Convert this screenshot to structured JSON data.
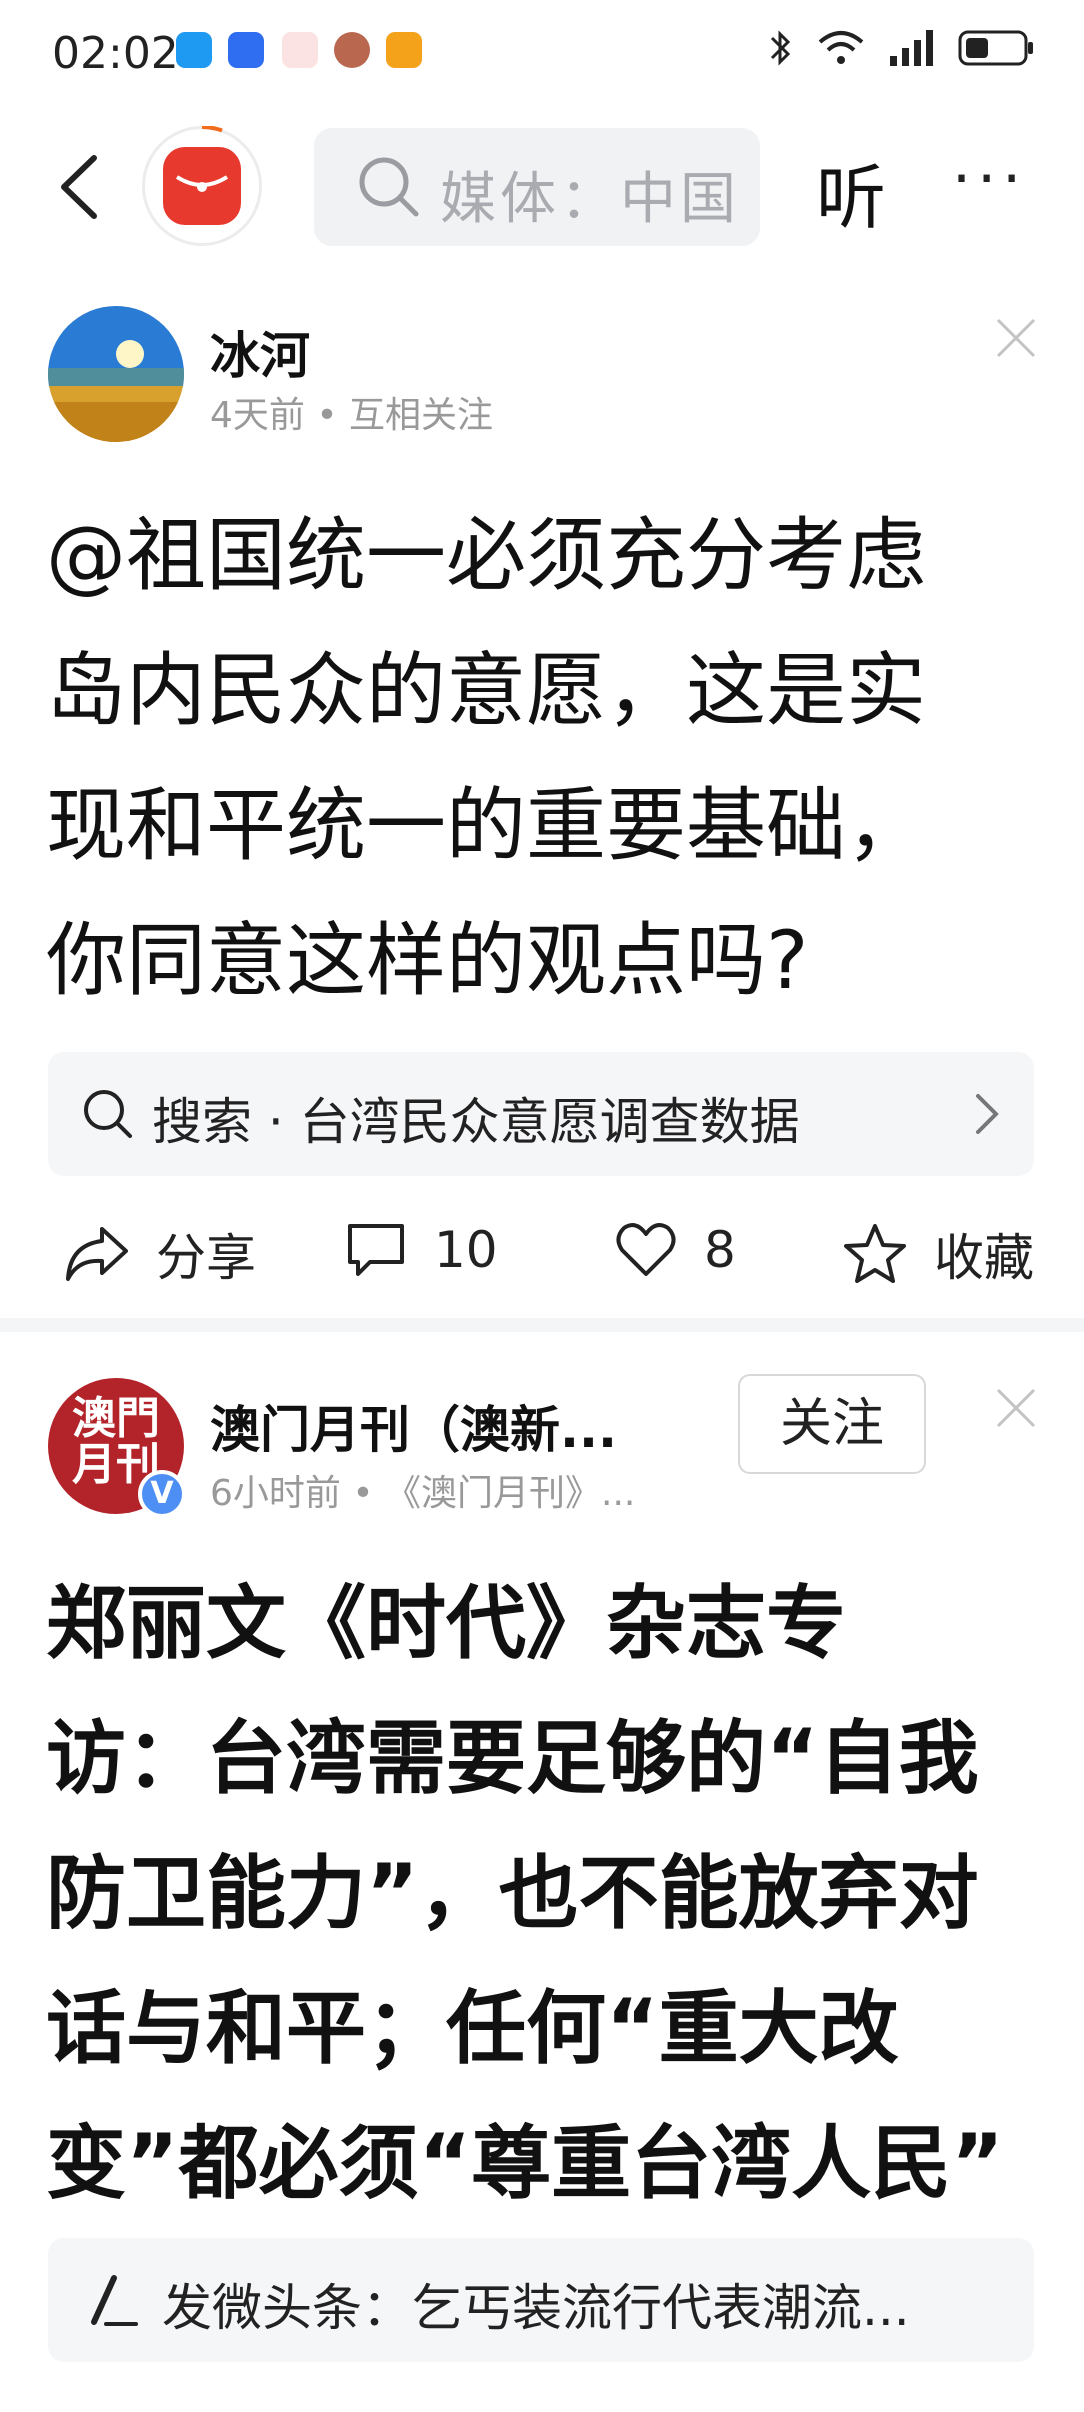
{
  "status_bar": {
    "time": "02:02",
    "notification_icons": [
      "chat-bubble-icon",
      "bulb-icon",
      "red-box-icon",
      "avatar-app-icon",
      "video-play-icon"
    ],
    "right_icons": [
      "bluetooth-icon",
      "wifi-icon",
      "signal-icon",
      "battery-icon"
    ]
  },
  "toolbar": {
    "search_placeholder": "媒体：中国",
    "listen_label": "听",
    "more_label": "···"
  },
  "feed": {
    "post1": {
      "author": "冰河",
      "meta": "4天前 • 互相关注",
      "headline_lines": [
        "@祖国统一必须充分考虑",
        "岛内民众的意愿，这是实",
        "现和平统一的重要基础，",
        "你同意这样的观点吗?"
      ],
      "search_suggestion": "搜索 · 台湾民众意愿调查数据",
      "share_label": "分享",
      "comments_count": "10",
      "likes_count": "8",
      "favorite_label": "收藏"
    },
    "post2": {
      "author": "澳门月刊（澳新...",
      "avatar_text": "澳門月刊",
      "verified_label": "V",
      "meta": "6小时前 • 《澳门月刊》...",
      "follow_label": "关注",
      "headline_lines": [
        "郑丽文《时代》杂志专",
        "访：台湾需要足够的“自我",
        "防卫能力”，也不能放弃对",
        "话与和平；任何“重大改",
        "变”都必须“尊重台湾人民”"
      ],
      "related_tip": "发微头条：乞丐装流行代表潮流..."
    }
  },
  "colors": {
    "accent_red": "#e8392e",
    "verify_blue": "#4d8ff5",
    "meta_gray": "#999999"
  }
}
